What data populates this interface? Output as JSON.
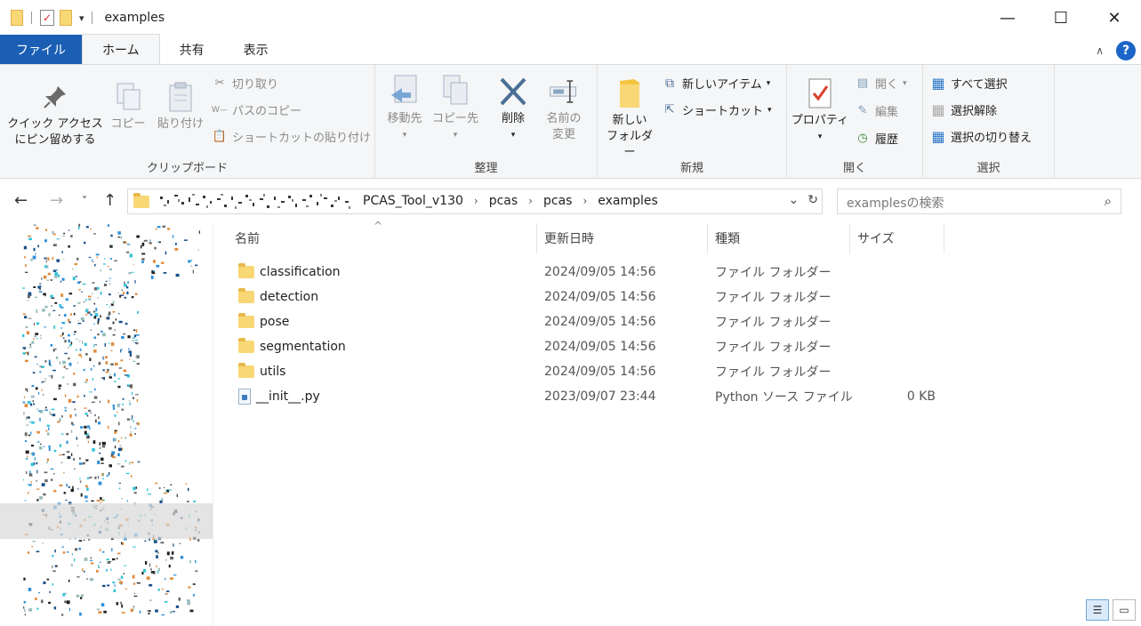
{
  "window": {
    "title": "examples"
  },
  "tabs": [
    {
      "label": "ファイル"
    },
    {
      "label": "ホーム"
    },
    {
      "label": "共有"
    },
    {
      "label": "表示"
    }
  ],
  "ribbon": {
    "clipboard": {
      "label": "クリップボード",
      "pin_l1": "クイック アクセス",
      "pin_l2": "にピン留めする",
      "copy": "コピー",
      "paste": "貼り付け",
      "cut": "切り取り",
      "copy_path": "パスのコピー",
      "paste_shortcut": "ショートカットの貼り付け"
    },
    "organize": {
      "label": "整理",
      "move_to": "移動先",
      "copy_to": "コピー先",
      "delete": "削除",
      "rename_l1": "名前の",
      "rename_l2": "変更"
    },
    "new": {
      "label": "新規",
      "new_folder_l1": "新しい",
      "new_folder_l2": "フォルダー",
      "new_item": "新しいアイテム",
      "shortcut": "ショートカット"
    },
    "open": {
      "label": "開く",
      "properties": "プロパティ",
      "open": "開く",
      "edit": "編集",
      "history": "履歴"
    },
    "select": {
      "label": "選択",
      "select_all": "すべて選択",
      "select_none": "選択解除",
      "invert": "選択の切り替え"
    }
  },
  "address": {
    "crumbs": [
      "PCAS_Tool_v130",
      "pcas",
      "pcas",
      "examples"
    ],
    "search_placeholder": "examplesの検索"
  },
  "columns": {
    "name": "名前",
    "date": "更新日時",
    "type": "種類",
    "size": "サイズ"
  },
  "files": [
    {
      "name": "classification",
      "date": "2024/09/05 14:56",
      "type": "ファイル フォルダー",
      "size": "",
      "kind": "folder"
    },
    {
      "name": "detection",
      "date": "2024/09/05 14:56",
      "type": "ファイル フォルダー",
      "size": "",
      "kind": "folder"
    },
    {
      "name": "pose",
      "date": "2024/09/05 14:56",
      "type": "ファイル フォルダー",
      "size": "",
      "kind": "folder"
    },
    {
      "name": "segmentation",
      "date": "2024/09/05 14:56",
      "type": "ファイル フォルダー",
      "size": "",
      "kind": "folder"
    },
    {
      "name": "utils",
      "date": "2024/09/05 14:56",
      "type": "ファイル フォルダー",
      "size": "",
      "kind": "folder"
    },
    {
      "name": "__init__.py",
      "date": "2023/09/07 23:44",
      "type": "Python ソース ファイル",
      "size": "0 KB",
      "kind": "python"
    }
  ]
}
